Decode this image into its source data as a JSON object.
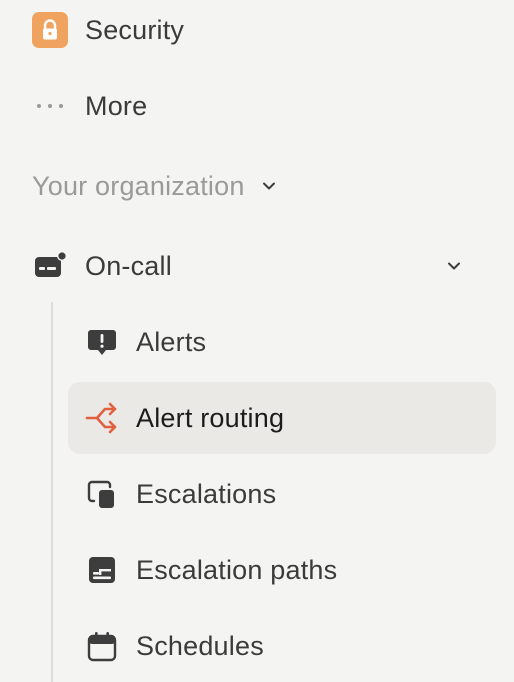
{
  "sidebar": {
    "top_items": [
      {
        "label": "Security",
        "icon": "lock-icon"
      },
      {
        "label": "More",
        "icon": "more-dots-icon"
      }
    ],
    "section": {
      "label": "Your organization",
      "icon": "chevron-down-icon"
    },
    "group": {
      "label": "On-call",
      "icon": "pager-icon",
      "expanded": true,
      "children": [
        {
          "label": "Alerts",
          "icon": "alert-bubble-icon",
          "active": false
        },
        {
          "label": "Alert routing",
          "icon": "routing-split-icon",
          "active": true
        },
        {
          "label": "Escalations",
          "icon": "escalation-icon",
          "active": false
        },
        {
          "label": "Escalation paths",
          "icon": "escalation-paths-icon",
          "active": false
        },
        {
          "label": "Schedules",
          "icon": "calendar-icon",
          "active": false
        }
      ]
    }
  },
  "colors": {
    "background": "#f4f4f2",
    "active_background": "#ebe9e5",
    "security_badge": "#f0a35e",
    "accent_orange": "#e0603f",
    "text": "#3b3b3b",
    "muted_text": "#9a9a96",
    "icon": "#3d3d3d"
  }
}
